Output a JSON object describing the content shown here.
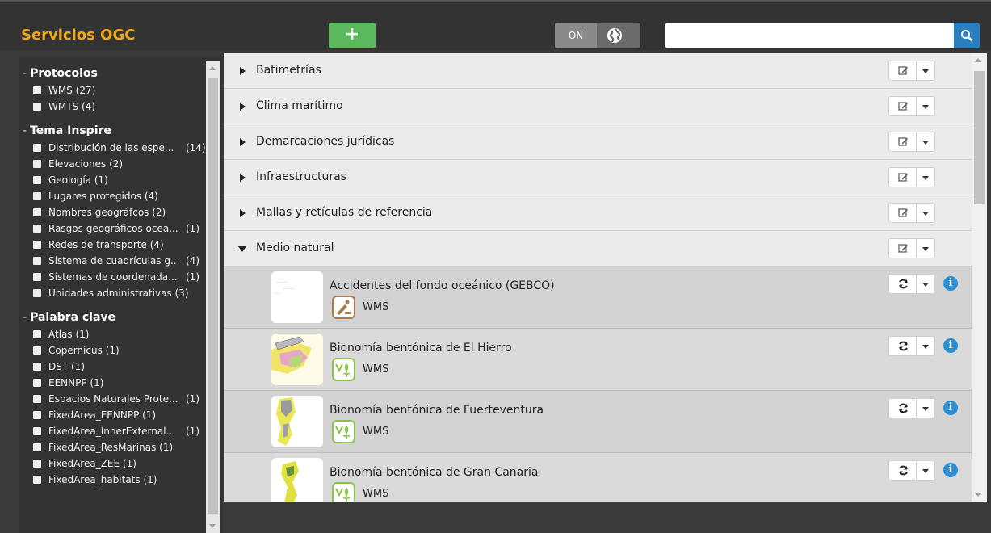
{
  "header": {
    "app_title": "Servicios OGC",
    "add_label": "+",
    "toggle_on_label": "ON",
    "search_placeholder": "",
    "search_value": ""
  },
  "sidebar": {
    "groups": [
      {
        "title": "Protocolos",
        "items": [
          {
            "label": "WMS (27)",
            "count": ""
          },
          {
            "label": "WMTS (4)",
            "count": ""
          }
        ]
      },
      {
        "title": "Tema Inspire",
        "items": [
          {
            "label": "Distribución de las espe...",
            "count": "(14)"
          },
          {
            "label": "Elevaciones (2)",
            "count": ""
          },
          {
            "label": "Geología (1)",
            "count": ""
          },
          {
            "label": "Lugares protegidos (4)",
            "count": ""
          },
          {
            "label": "Nombres geográfcos (2)",
            "count": ""
          },
          {
            "label": "Rasgos geográficos ocea...",
            "count": "(1)"
          },
          {
            "label": "Redes de transporte (4)",
            "count": ""
          },
          {
            "label": "Sistema de cuadrículas g...",
            "count": "(4)"
          },
          {
            "label": "Sistemas de coordenada...",
            "count": "(1)"
          },
          {
            "label": "Unidades administrativas (3)",
            "count": ""
          }
        ]
      },
      {
        "title": "Palabra clave",
        "items": [
          {
            "label": "Atlas (1)",
            "count": ""
          },
          {
            "label": "Copernicus (1)",
            "count": ""
          },
          {
            "label": "DST (1)",
            "count": ""
          },
          {
            "label": "EENNPP (1)",
            "count": ""
          },
          {
            "label": "Espacios Naturales Prote...",
            "count": "(1)"
          },
          {
            "label": "FixedArea_EENNPP (1)",
            "count": ""
          },
          {
            "label": "FixedArea_InnerExternal...",
            "count": "(1)"
          },
          {
            "label": "FixedArea_ResMarinas (1)",
            "count": ""
          },
          {
            "label": "FixedArea_ZEE (1)",
            "count": ""
          },
          {
            "label": "FixedArea_habitats (1)",
            "count": ""
          }
        ]
      }
    ]
  },
  "categories": [
    {
      "label": "Batimetrías",
      "expanded": false
    },
    {
      "label": "Clima marítimo",
      "expanded": false
    },
    {
      "label": "Demarcaciones jurídicas",
      "expanded": false
    },
    {
      "label": "Infraestructuras",
      "expanded": false
    },
    {
      "label": "Mallas y retículas de referencia",
      "expanded": false
    },
    {
      "label": "Medio natural",
      "expanded": true
    }
  ],
  "services": [
    {
      "title": "Accidentes del fondo oceánico (GEBCO)",
      "protocol": "WMS",
      "icon": "geology-icon"
    },
    {
      "title": "Bionomía bentónica de El Hierro",
      "protocol": "WMS",
      "icon": "biodiversity-icon"
    },
    {
      "title": "Bionomía bentónica de Fuerteventura",
      "protocol": "WMS",
      "icon": "biodiversity-icon"
    },
    {
      "title": "Bionomía bentónica de Gran Canaria",
      "protocol": "WMS",
      "icon": "biodiversity-icon"
    }
  ],
  "colors": {
    "accent": "#f0a818",
    "add_button": "#5cb85c",
    "search_button": "#2a7fc0",
    "info": "#2a8fd6"
  }
}
